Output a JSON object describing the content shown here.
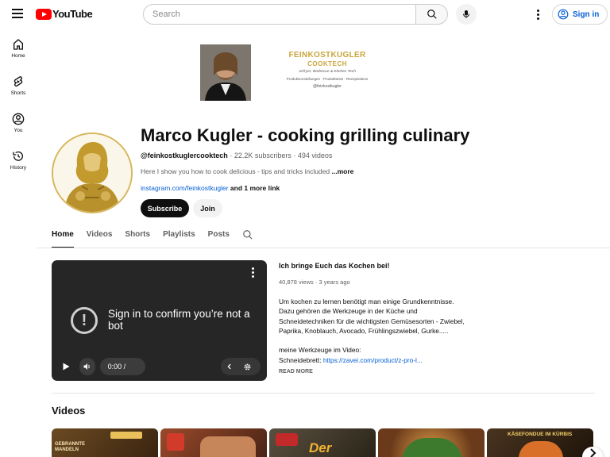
{
  "header": {
    "logo_text": "YouTube",
    "search_placeholder": "Search",
    "sign_in_label": "Sign in"
  },
  "sidebar": {
    "items": [
      {
        "label": "Home",
        "icon": "home-icon"
      },
      {
        "label": "Shorts",
        "icon": "shorts-icon"
      },
      {
        "label": "You",
        "icon": "you-icon"
      },
      {
        "label": "History",
        "icon": "history-icon"
      }
    ]
  },
  "banner": {
    "line1": "FEINKOSTKUGLER",
    "line2": "COOKTECH",
    "line3": "Airfryer, Barbecue & Kitchen Tech",
    "line4": "Produktvorstellungen · Produkttests · Rezeptvideos",
    "line5": "@feinkostkugler"
  },
  "channel": {
    "title": "Marco Kugler - cooking grilling culinary",
    "handle": "@feinkostkuglercooktech",
    "subscribers": "22.2K subscribers",
    "videos_count": "494 videos",
    "description": "Here I show you how to cook delicious - tips and tricks included",
    "more_label": "...more",
    "link_text": "instagram.com/feinkostkugler",
    "more_links": "and 1 more link",
    "subscribe_label": "Subscribe",
    "join_label": "Join"
  },
  "tabs": [
    "Home",
    "Videos",
    "Shorts",
    "Playlists",
    "Posts"
  ],
  "player": {
    "message": "Sign in to confirm you’re not a bot",
    "time": "0:00 / 0:00"
  },
  "featured": {
    "title": "Ich bringe Euch das Kochen bei!",
    "views": "40,878 views",
    "age": "3 years ago",
    "desc_lines": [
      "Um kochen zu lernen benötigt man einige Grundkenntnisse.",
      "Dazu gehören die Werkzeuge in der Küche und",
      "Schneidetechniken für die wichtigsten Gemüsesorten - Zwiebel,",
      "Paprika, Knoblauch, Avocado, Frühlingszwiebel, Gurke.....",
      "",
      "meine Werkzeuge im Video:"
    ],
    "tool_label": "Schneidebrett: ",
    "tool_link": "https://zavei.com/product/z-pro-l...",
    "read_more": "READ MORE"
  },
  "shelf": {
    "title": "Videos",
    "thumbs": [
      {
        "caption": "GEBRANNTE\nMANDELN",
        "color": "#5a3a1c"
      },
      {
        "caption": "",
        "color": "#7a3a2a"
      },
      {
        "caption": "Der",
        "color": "#4a4030"
      },
      {
        "caption": "",
        "color": "#8a5a2a"
      },
      {
        "caption": "KÄSEFONDUE IM KÜRBIS",
        "color": "#3a2a1c"
      }
    ]
  }
}
